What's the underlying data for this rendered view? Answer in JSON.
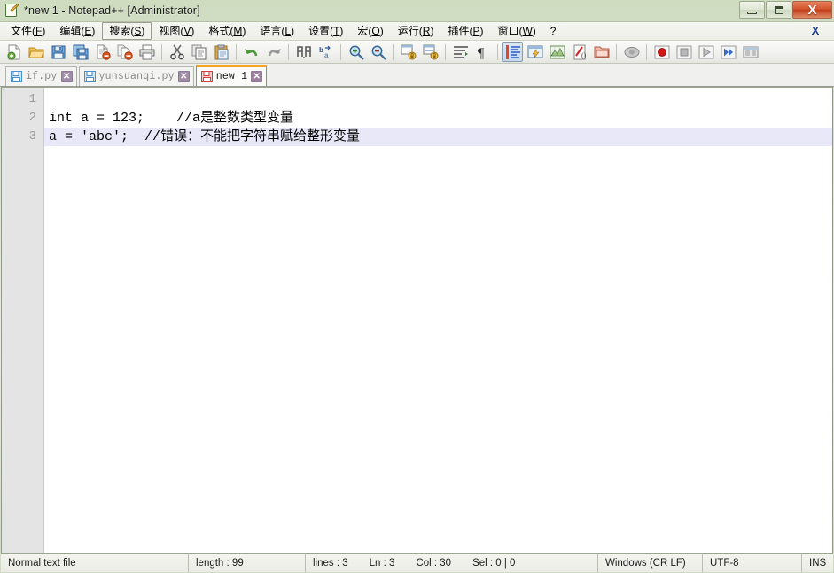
{
  "window": {
    "title": "*new 1 - Notepad++ [Administrator]",
    "app_icon": "notepad-plus-plus-icon",
    "controls": {
      "minimize": "minimize-icon",
      "restore": "restore-icon",
      "close": "X"
    }
  },
  "menubar": {
    "items": [
      {
        "label": "文件(F)",
        "mnemonic": "F",
        "text": "文件(",
        "close": ")",
        "active": false
      },
      {
        "label": "编辑(E)",
        "mnemonic": "E",
        "text": "编辑(",
        "close": ")",
        "active": false
      },
      {
        "label": "搜索(S)",
        "mnemonic": "S",
        "text": "搜索(",
        "close": ")",
        "active": true
      },
      {
        "label": "视图(V)",
        "mnemonic": "V",
        "text": "视图(",
        "close": ")",
        "active": false
      },
      {
        "label": "格式(M)",
        "mnemonic": "M",
        "text": "格式(",
        "close": ")",
        "active": false
      },
      {
        "label": "语言(L)",
        "mnemonic": "L",
        "text": "语言(",
        "close": ")",
        "active": false
      },
      {
        "label": "设置(T)",
        "mnemonic": "T",
        "text": "设置(",
        "close": ")",
        "active": false
      },
      {
        "label": "宏(O)",
        "mnemonic": "O",
        "text": "宏(",
        "close": ")",
        "active": false
      },
      {
        "label": "运行(R)",
        "mnemonic": "R",
        "text": "运行(",
        "close": ")",
        "active": false
      },
      {
        "label": "插件(P)",
        "mnemonic": "P",
        "text": "插件(",
        "close": ")",
        "active": false
      },
      {
        "label": "窗口(W)",
        "mnemonic": "W",
        "text": "窗口(",
        "close": ")",
        "active": false
      },
      {
        "label": "?",
        "mnemonic": "",
        "text": "?",
        "close": "",
        "active": false
      }
    ],
    "document_close": "X"
  },
  "toolbar": {
    "buttons": [
      {
        "name": "new-file-icon",
        "group": 0,
        "pressed": false
      },
      {
        "name": "open-file-icon",
        "group": 0,
        "pressed": false
      },
      {
        "name": "save-icon",
        "group": 0,
        "pressed": false
      },
      {
        "name": "save-all-icon",
        "group": 0,
        "pressed": false
      },
      {
        "name": "close-file-icon",
        "group": 0,
        "pressed": false
      },
      {
        "name": "close-all-files-icon",
        "group": 0,
        "pressed": false
      },
      {
        "name": "print-icon",
        "group": 0,
        "pressed": false
      },
      {
        "name": "cut-icon",
        "group": 1,
        "pressed": false
      },
      {
        "name": "copy-icon",
        "group": 1,
        "pressed": false
      },
      {
        "name": "paste-icon",
        "group": 1,
        "pressed": false
      },
      {
        "name": "undo-icon",
        "group": 2,
        "pressed": false
      },
      {
        "name": "redo-icon",
        "group": 2,
        "pressed": false
      },
      {
        "name": "find-icon",
        "group": 3,
        "pressed": false
      },
      {
        "name": "replace-icon",
        "group": 3,
        "pressed": false
      },
      {
        "name": "zoom-in-icon",
        "group": 4,
        "pressed": false
      },
      {
        "name": "zoom-out-icon",
        "group": 4,
        "pressed": false
      },
      {
        "name": "sync-vertical-scroll-icon",
        "group": 5,
        "pressed": false
      },
      {
        "name": "sync-horizontal-scroll-icon",
        "group": 5,
        "pressed": false
      },
      {
        "name": "word-wrap-icon",
        "group": 6,
        "pressed": false
      },
      {
        "name": "show-all-characters-icon",
        "group": 6,
        "pressed": false
      },
      {
        "name": "indent-guideline-icon",
        "group": 7,
        "pressed": true
      },
      {
        "name": "user-defined-dialog-icon",
        "group": 7,
        "pressed": false
      },
      {
        "name": "document-map-icon",
        "group": 7,
        "pressed": false
      },
      {
        "name": "function-list-icon",
        "group": 7,
        "pressed": false
      },
      {
        "name": "folder-as-workspace-icon",
        "group": 7,
        "pressed": false
      },
      {
        "name": "monitoring-icon",
        "group": 8,
        "pressed": false
      },
      {
        "name": "record-macro-icon",
        "group": 9,
        "pressed": false
      },
      {
        "name": "stop-recording-icon",
        "group": 9,
        "pressed": false
      },
      {
        "name": "play-macro-icon",
        "group": 9,
        "pressed": false
      },
      {
        "name": "run-macro-multiple-icon",
        "group": 9,
        "pressed": false
      },
      {
        "name": "save-macro-icon",
        "group": 9,
        "pressed": false
      }
    ]
  },
  "tabs": [
    {
      "label": "if.py",
      "active": false,
      "modified": false,
      "close": "✕",
      "icon": "saved-file-icon"
    },
    {
      "label": "yunsuanqi.py",
      "active": false,
      "modified": false,
      "close": "✕",
      "icon": "saved-file-icon"
    },
    {
      "label": "new 1",
      "active": true,
      "modified": true,
      "close": "✕",
      "icon": "unsaved-file-icon"
    }
  ],
  "editor": {
    "line_numbers": [
      "1",
      "2",
      "3"
    ],
    "lines": [
      {
        "number": "1",
        "text": "",
        "current": false
      },
      {
        "number": "2",
        "text": "int a = 123;    //a是整数类型变量",
        "current": false
      },
      {
        "number": "3",
        "text": "a = 'abc';  //错误：不能把字符串赋给整形变量",
        "current": true
      }
    ],
    "current_line_highlight": "#e8e8f8",
    "background": "#ffffff",
    "text_color": "#000000",
    "gutter_background": "#e4e4e4",
    "gutter_text_color": "#9a9a9a"
  },
  "statusbar": {
    "file_type": "Normal text file",
    "length_label": "length : 99",
    "lines_label": "lines : 3",
    "ln": "Ln : 3",
    "col": "Col : 30",
    "sel": "Sel : 0 | 0",
    "eol": "Windows (CR LF)",
    "encoding": "UTF-8",
    "insert_mode": "INS"
  },
  "colors": {
    "title_accent": "#f5a623",
    "close_button": "#d4562f",
    "frame": "#cfdcc0",
    "current_line": "#e8e8f8"
  }
}
